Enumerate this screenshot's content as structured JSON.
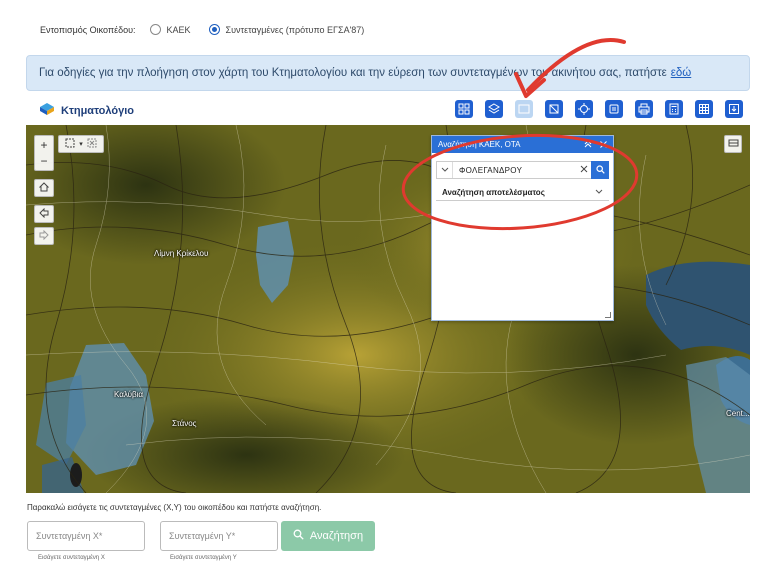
{
  "locate": {
    "label": "Εντοπισμός Οικοπέδου:",
    "options": [
      {
        "label": "ΚΑΕΚ",
        "checked": false
      },
      {
        "label": "Συντεταγμένες (πρότυπο ΕΓΣΑ'87)",
        "checked": true
      }
    ]
  },
  "banner": {
    "text": "Για οδηγίες για την πλοήγηση στον χάρτη του Κτηματολογίου και την εύρεση των συντεταγμένων του ακινήτου σας, πατήστε",
    "link": "εδώ"
  },
  "brand": {
    "name": "Κτηματολόγιο"
  },
  "toolbar": {
    "icons": [
      "layers-grid-icon",
      "layers-stack-icon",
      "search-box-icon",
      "measure-icon",
      "locate-icon",
      "print-icon",
      "printer-icon",
      "calculator-icon",
      "grid-icon",
      "export-icon"
    ]
  },
  "map": {
    "controls": {
      "zoom_in": "+",
      "zoom_out": "−"
    },
    "labels": [
      "Λίμνη Κρίκελου",
      "Καλύβια",
      "Στάνος",
      "Cent..."
    ]
  },
  "panel": {
    "title": "Αναζήτηση ΚΑΕΚ, ΟΤΑ",
    "search_value": "ΦΟΛΕΓΑΝΔΡΟΥ",
    "result_label": "Αναζήτηση αποτελέσματος"
  },
  "form": {
    "instructions": "Παρακαλώ εισάγετε τις συντεταγμένες (Χ,Υ) του οικοπέδου και πατήστε αναζήτηση.",
    "x_placeholder": "Συντεταγμένη Χ*",
    "y_placeholder": "Συντεταγμένη Υ*",
    "x_hint": "Εισάγετε συντεταγμένη Χ",
    "y_hint": "Εισάγετε συντεταγμένη Υ",
    "search_label": "Αναζήτηση"
  },
  "colors": {
    "primary": "#2a6fd6",
    "annotation": "#e03a2f",
    "search_button": "#8cc9a8"
  }
}
